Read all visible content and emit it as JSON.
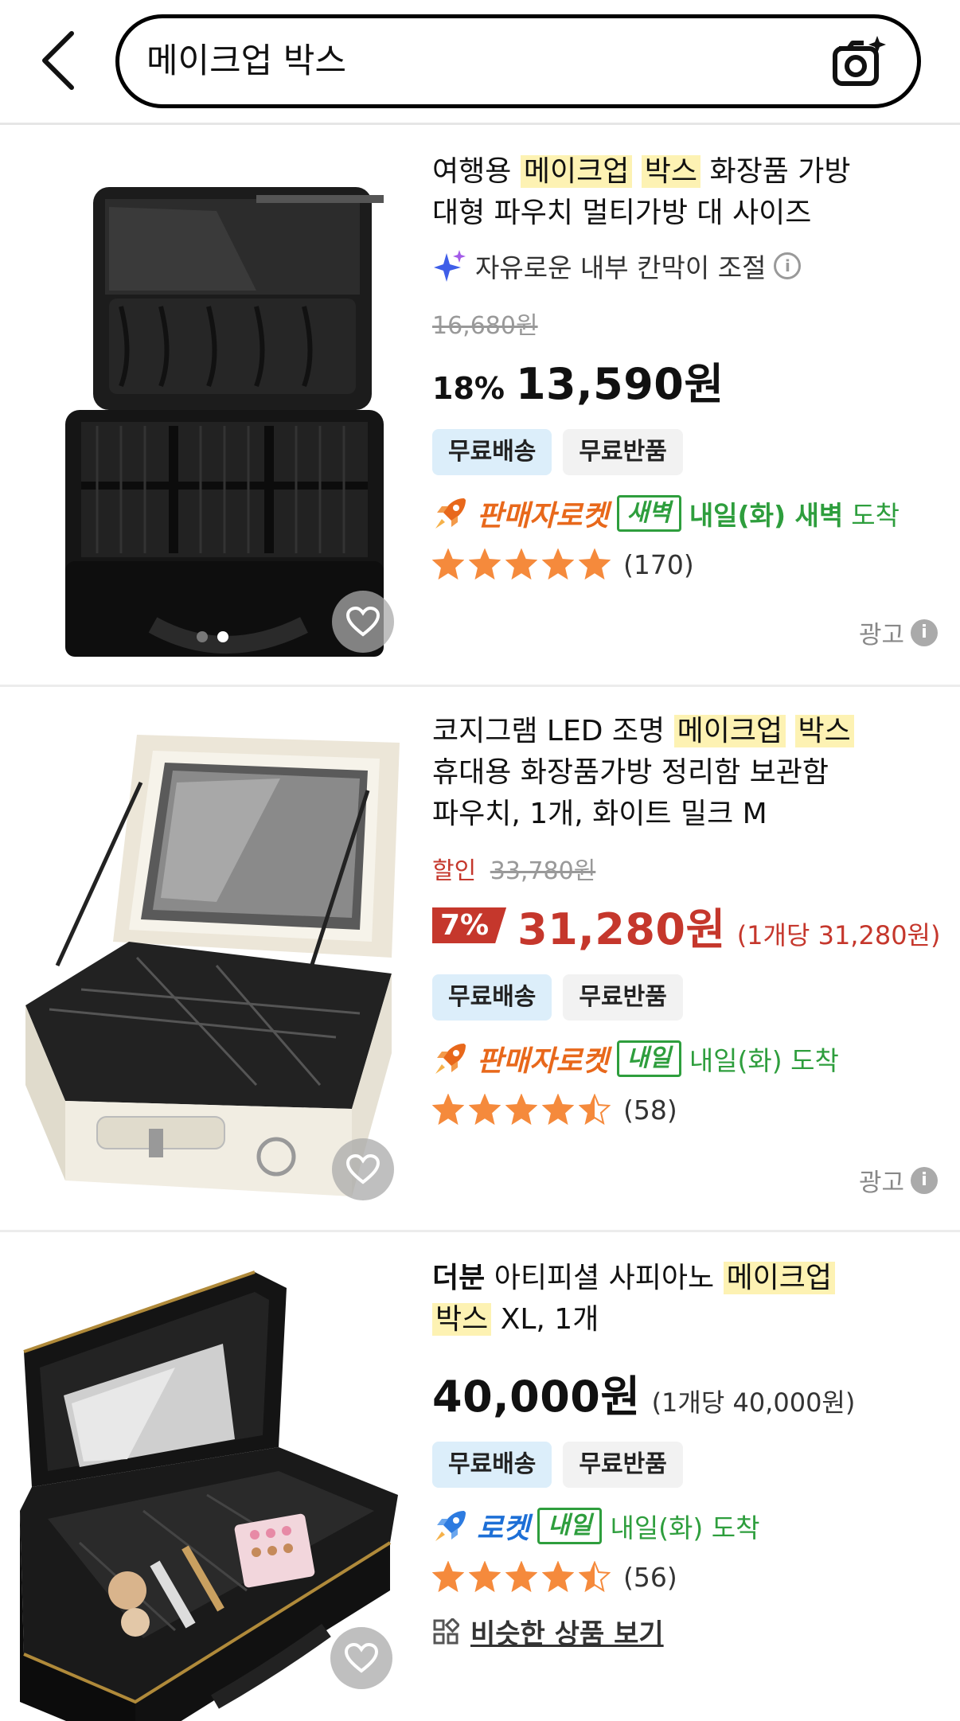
{
  "search": {
    "query": "메이크업 박스"
  },
  "products": [
    {
      "title_prefix": "여행용",
      "title_hl1": "메이크업",
      "title_hl2": "박스",
      "title_suffix": "화장품 가방",
      "title_line2": "대형 파우치 멀티가방 대 사이즈",
      "feature": "자유로운 내부 칸막이 조절",
      "original_price": "16,680원",
      "discount": "18%",
      "price": "13,590원",
      "badge_ship": "무료배송",
      "badge_return": "무료반품",
      "rocket_label": "판매자로켓",
      "delivery_tag": "새벽",
      "delivery_day": "내일(화) 새벽",
      "delivery_arrive": "도착",
      "rating": 5,
      "review_count": "(170)",
      "ad_label": "광고",
      "image_index": 2,
      "image_count": 2
    },
    {
      "title_prefix": "코지그램 LED 조명",
      "title_hl1": "메이크업",
      "title_hl2": "박스",
      "title_line2": "휴대용 화장품가방 정리함 보관함",
      "title_line3": "파우치, 1개, 화이트 밀크 M",
      "sale_label": "할인",
      "original_price": "33,780원",
      "discount": "7%",
      "price": "31,280원",
      "unit_price": "(1개당 31,280원)",
      "badge_ship": "무료배송",
      "badge_return": "무료반품",
      "rocket_label": "판매자로켓",
      "delivery_tag": "내일",
      "delivery_text": "내일(화) 도착",
      "rating": 4.5,
      "review_count": "(58)",
      "ad_label": "광고"
    },
    {
      "brand": "더분",
      "title_prefix": "아티피셜 사피아노",
      "title_hl1": "메이크업",
      "title_hl2": "박스",
      "title_suffix": "XL, 1개",
      "price": "40,000원",
      "unit_price": "(1개당 40,000원)",
      "badge_ship": "무료배송",
      "badge_return": "무료반품",
      "rocket_label": "로켓",
      "delivery_tag": "내일",
      "delivery_text": "내일(화) 도착",
      "rating": 4.5,
      "review_count": "(56)",
      "similar_label": "비슷한 상품 보기"
    }
  ],
  "colors": {
    "highlight": "#fdf2b3",
    "rocket_orange": "#e8681b",
    "rocket_blue": "#1d6fd6",
    "delivery_green": "#2e9e3d",
    "sale_red": "#c5372c",
    "star": "#f58a3c"
  }
}
